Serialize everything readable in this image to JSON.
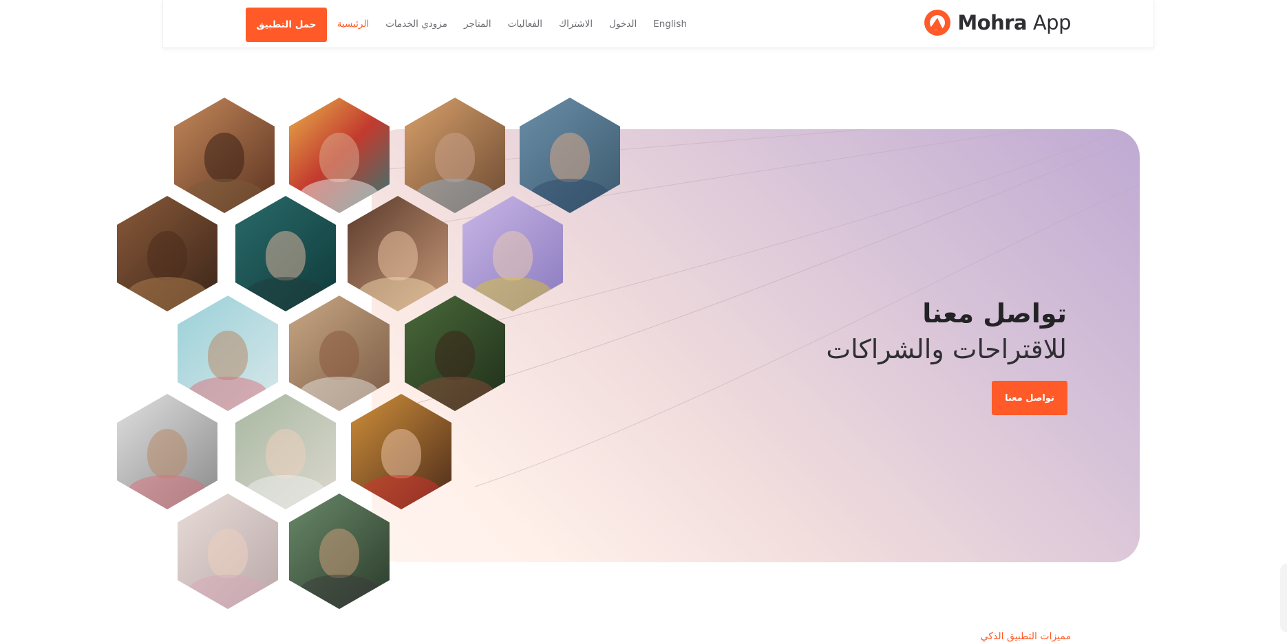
{
  "brand": {
    "name_bold": "Mohra",
    "name_light": "App",
    "accent": "#ff5a28"
  },
  "nav": {
    "items": [
      {
        "label": "الرئيسية",
        "active": true
      },
      {
        "label": "مزودي الخدمات"
      },
      {
        "label": "المتاجر"
      },
      {
        "label": "الفعاليات"
      },
      {
        "label": "الاشتراك"
      },
      {
        "label": "الدخول"
      },
      {
        "label": "English"
      }
    ],
    "download_label": "حمل التطبيق"
  },
  "hero": {
    "title": "تواصل معنا",
    "subtitle": "للاقتراحات والشراكات",
    "button_label": "تواصل معنا"
  },
  "photos": [
    "person-photo-1",
    "person-photo-2",
    "person-photo-3",
    "person-photo-4",
    "person-photo-5",
    "person-photo-6",
    "person-photo-7",
    "person-photo-8",
    "person-photo-9",
    "person-photo-10",
    "person-photo-11",
    "person-photo-12",
    "person-photo-13",
    "person-photo-14",
    "person-photo-15",
    "person-photo-16"
  ],
  "footer_peek": "مميزات التطبيق الذكي"
}
